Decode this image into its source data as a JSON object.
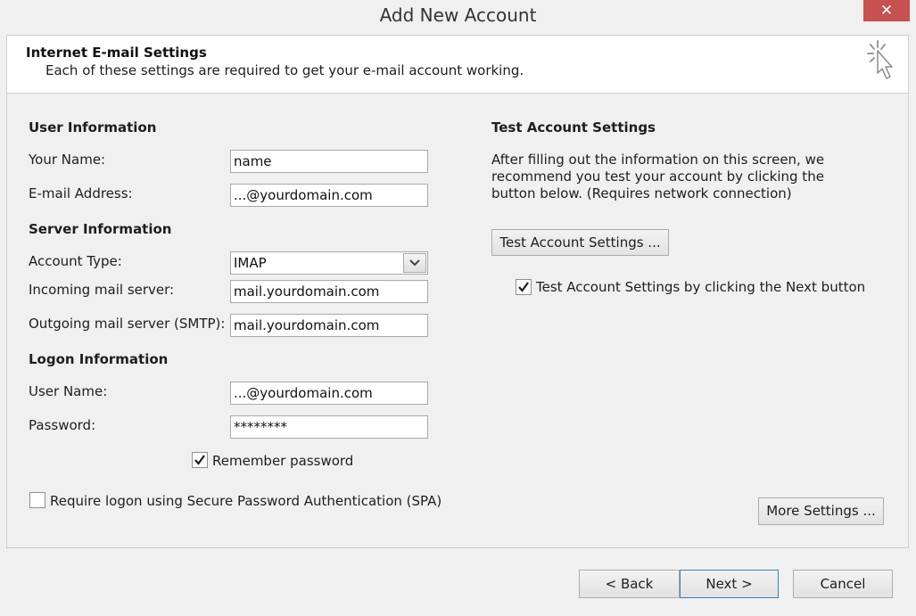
{
  "window": {
    "title": "Add New Account",
    "close_symbol": "✕"
  },
  "header": {
    "title": "Internet E-mail Settings",
    "subtitle": "Each of these settings are required to get your e-mail account working.",
    "icon": "wizard-cursor-icon"
  },
  "user_info": {
    "heading": "User Information",
    "name_label": "Your Name:",
    "name_value": "name",
    "email_label": "E-mail Address:",
    "email_value": "...@yourdomain.com"
  },
  "server_info": {
    "heading": "Server Information",
    "account_type_label": "Account Type:",
    "account_type_value": "IMAP",
    "incoming_label": "Incoming mail server:",
    "incoming_value": "mail.yourdomain.com",
    "outgoing_label": "Outgoing mail server (SMTP):",
    "outgoing_value": "mail.yourdomain.com"
  },
  "logon_info": {
    "heading": "Logon Information",
    "username_label": "User Name:",
    "username_value": "...@yourdomain.com",
    "password_label": "Password:",
    "password_value": "********",
    "remember_label": "Remember password",
    "remember_checked": true,
    "spa_label": "Require logon using Secure Password Authentication (SPA)",
    "spa_checked": false
  },
  "test_settings": {
    "heading": "Test Account Settings",
    "description": "After filling out the information on this screen, we recommend you test your account by clicking the button below. (Requires network connection)",
    "button_label": "Test Account Settings ...",
    "auto_test_label": "Test Account Settings by clicking the Next button",
    "auto_test_checked": true
  },
  "buttons": {
    "more_settings": "More Settings ...",
    "back": "< Back",
    "next": "Next >",
    "cancel": "Cancel"
  }
}
